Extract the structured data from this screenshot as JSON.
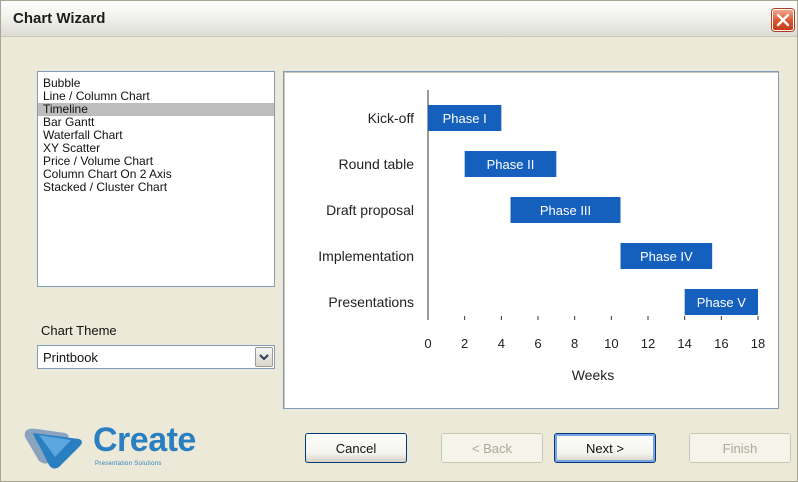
{
  "window": {
    "title": "Chart Wizard"
  },
  "chart_types": {
    "items": [
      "Bubble",
      "Line / Column Chart",
      "Timeline",
      "Bar Gantt",
      "Waterfall Chart",
      "XY Scatter",
      "Price / Volume Chart",
      "Column Chart On 2 Axis",
      "Stacked / Cluster Chart"
    ],
    "selected_index": 2
  },
  "theme": {
    "label": "Chart Theme",
    "value": "Printbook"
  },
  "logo": {
    "word": "Create",
    "tagline": "Presentation Solutions"
  },
  "buttons": {
    "cancel": "Cancel",
    "back": "< Back",
    "next": "Next >",
    "finish": "Finish"
  },
  "colors": {
    "bar": "#1560bd",
    "selection": "#bdbdbd",
    "close_button": "#d9532d"
  },
  "chart_data": {
    "type": "bar",
    "orientation": "horizontal",
    "categories": [
      "Kick-off",
      "Round table",
      "Draft proposal",
      "Implementation",
      "Presentations"
    ],
    "series": [
      {
        "bars": [
          {
            "label": "Phase I",
            "start": 0,
            "end": 4
          },
          {
            "label": "Phase II",
            "start": 2,
            "end": 7
          },
          {
            "label": "Phase III",
            "start": 4.5,
            "end": 10.5
          },
          {
            "label": "Phase IV",
            "start": 10.5,
            "end": 15.5
          },
          {
            "label": "Phase V",
            "start": 14,
            "end": 18
          }
        ]
      }
    ],
    "xlabel": "Weeks",
    "ylabel": "",
    "xlim": [
      0,
      18
    ],
    "xticks": [
      0,
      2,
      4,
      6,
      8,
      10,
      12,
      14,
      16,
      18
    ],
    "grid": false
  }
}
